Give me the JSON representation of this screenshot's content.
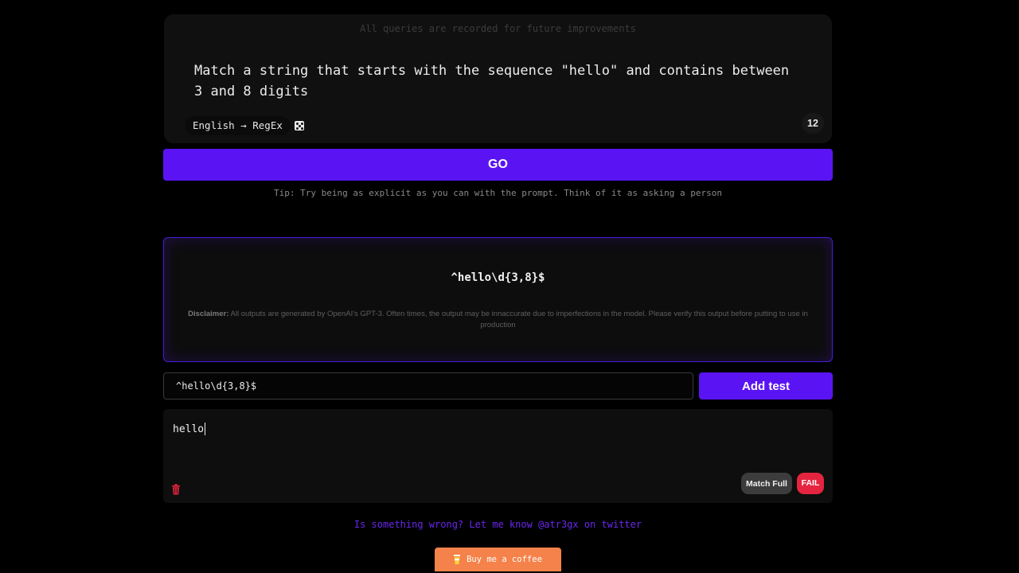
{
  "notice": "All queries are recorded for future improvements",
  "prompt": {
    "text": "Match a string that starts with the sequence \"hello\" and contains between 3 and 8 digits",
    "mode_label": "English → RegEx",
    "mode_icon": "dice-icon",
    "count": "12"
  },
  "go_label": "GO",
  "tip": "Tip: Try being as explicit as you can with the prompt. Think of it as asking a person",
  "result": {
    "regex": "^hello\\d{3,8}$",
    "disclaimer_label": "Disclaimer:",
    "disclaimer_text": " All outputs are generated by OpenAI's GPT-3. Often times, the output may be innaccurate due to imperfections in the model. Please verify this output before putting to use in production"
  },
  "tester": {
    "regex_value": "^hello\\d{3,8}$",
    "add_test_label": "Add test",
    "test_value": "hello",
    "match_label": "Match Full",
    "status": "FAIL"
  },
  "footer": {
    "feedback": "Is something wrong? Let me know @atr3gx on twitter",
    "coffee_label": "Buy me a coffee"
  },
  "colors": {
    "accent": "#5a14f4",
    "fail": "#e5243f",
    "coffee": "#f5824a"
  }
}
